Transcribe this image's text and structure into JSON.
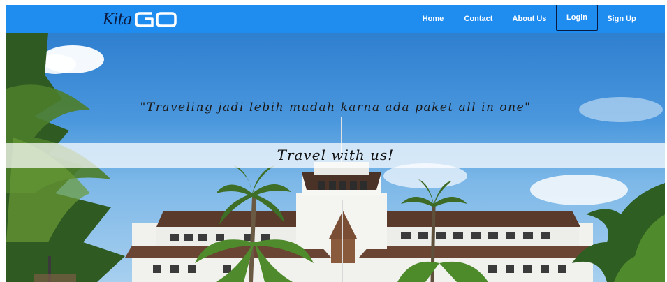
{
  "brand": {
    "script_text": "Kita",
    "logo_icon": "go-logo-icon"
  },
  "nav": {
    "home": "Home",
    "contact": "Contact",
    "about": "About Us",
    "login": "Login",
    "signup": "Sign Up"
  },
  "hero": {
    "quote": "\"Traveling jadi lebih mudah karna ada paket all in one\"",
    "tagline": "Travel with us!",
    "background_image": "gedung-sate-building-photo"
  },
  "colors": {
    "navbar": "#1f8cf0",
    "accent": "#0b1b3f"
  }
}
